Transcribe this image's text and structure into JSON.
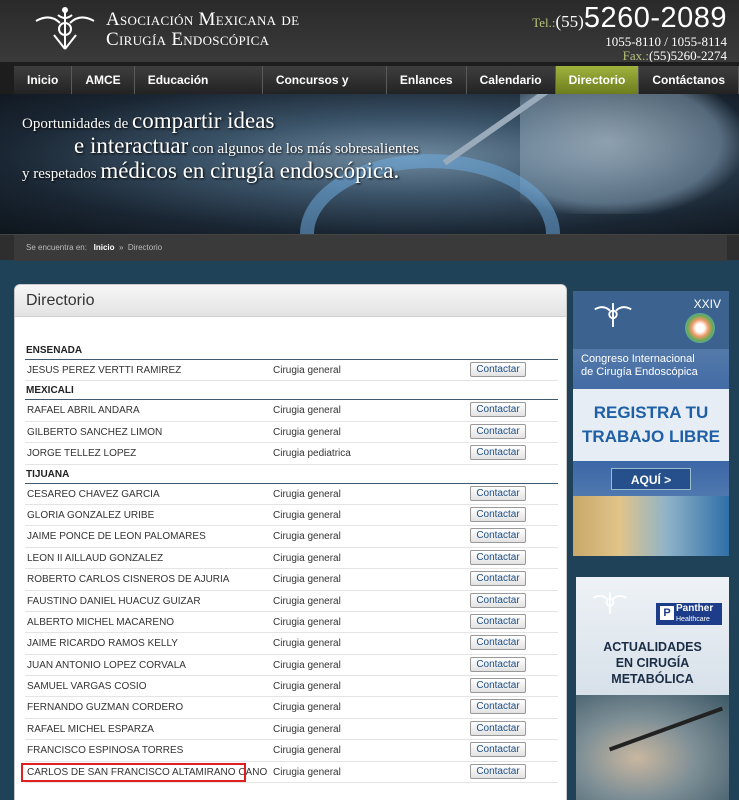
{
  "site": {
    "name_line1": "Asociación Mexicana de",
    "name_line2": "Cirugía Endoscópica",
    "tel_label": "Tel.:",
    "tel_prefix": "(55)",
    "tel_main": "5260-2089",
    "tel_other": "1055-8110 / 1055-8114",
    "fax_label": "Fax.:",
    "fax_number": "(55)5260-2274"
  },
  "nav": [
    {
      "label": "Inicio",
      "active": false
    },
    {
      "label": "AMCE",
      "active": false
    },
    {
      "label": "Educación Contínua",
      "active": false
    },
    {
      "label": "Concursos y Becas",
      "active": false
    },
    {
      "label": "Enlances",
      "active": false
    },
    {
      "label": "Calendario",
      "active": false
    },
    {
      "label": "Directorio",
      "active": true
    },
    {
      "label": "Contáctanos",
      "active": false
    }
  ],
  "banner": {
    "t1a": "Oportunidades de ",
    "t1b": "compartir ideas",
    "t2a": "e interactuar",
    "t2b": " con algunos de los más sobresalientes",
    "t3a": "y respetados ",
    "t3b": "médicos",
    "t3c": " en cirugía endoscópica."
  },
  "breadcrumb": {
    "label": "Se encuentra en:",
    "home": "Inicio",
    "sep": "»",
    "current": "Directorio"
  },
  "directory": {
    "title": "Directorio",
    "button_label": "Contactar",
    "groups": [
      {
        "city": "ENSENADA",
        "rows": [
          {
            "name": "JESUS PEREZ VERTTI RAMIREZ",
            "specialty": "Cirugia general"
          }
        ]
      },
      {
        "city": "MEXICALI",
        "rows": [
          {
            "name": "RAFAEL ABRIL ANDARA",
            "specialty": "Cirugia general"
          },
          {
            "name": "GILBERTO SANCHEZ LIMON",
            "specialty": "Cirugia general"
          },
          {
            "name": "JORGE TELLEZ LOPEZ",
            "specialty": "Cirugia pediatrica"
          }
        ]
      },
      {
        "city": "TIJUANA",
        "rows": [
          {
            "name": "CESAREO CHAVEZ GARCIA",
            "specialty": "Cirugia general"
          },
          {
            "name": "GLORIA GONZALEZ URIBE",
            "specialty": "Cirugia general"
          },
          {
            "name": "JAIME PONCE DE LEON PALOMARES",
            "specialty": "Cirugia general"
          },
          {
            "name": "LEON II AILLAUD GONZALEZ",
            "specialty": "Cirugia general"
          },
          {
            "name": "ROBERTO CARLOS CISNEROS DE AJURIA",
            "specialty": "Cirugia general"
          },
          {
            "name": "FAUSTINO DANIEL HUACUZ GUIZAR",
            "specialty": "Cirugia general"
          },
          {
            "name": "ALBERTO MICHEL MACARENO",
            "specialty": "Cirugia general"
          },
          {
            "name": "JAIME RICARDO RAMOS KELLY",
            "specialty": "Cirugia general"
          },
          {
            "name": "JUAN ANTONIO LOPEZ CORVALA",
            "specialty": "Cirugia general"
          },
          {
            "name": "SAMUEL VARGAS COSIO",
            "specialty": "Cirugia general"
          },
          {
            "name": "FERNANDO GUZMAN CORDERO",
            "specialty": "Cirugia general"
          },
          {
            "name": "RAFAEL MICHEL ESPARZA",
            "specialty": "Cirugia general"
          },
          {
            "name": "FRANCISCO ESPINOSA TORRES",
            "specialty": "Cirugia general"
          },
          {
            "name": "CARLOS DE SAN FRANCISCO ALTAMIRANO CANO",
            "specialty": "Cirugia general",
            "highlighted": true
          }
        ]
      }
    ]
  },
  "ad_congreso": {
    "edition": "XXIV",
    "line1": "Congreso Internacional",
    "line2": "de Cirugía Endoscópica",
    "cta1": "REGISTRA TU",
    "cta2": "TRABAJO LIBRE",
    "button": "AQUÍ >"
  },
  "ad_metabolica": {
    "sponsor": "Panther",
    "sponsor_sub": "Healthcare",
    "line1": "ACTUALIDADES",
    "line2": "EN CIRUGÍA",
    "line3": "METABÓLICA"
  },
  "colors": {
    "accent_nav_active": "#8a9e2b",
    "page_bg": "#1f4258",
    "highlight": "#e02020"
  }
}
